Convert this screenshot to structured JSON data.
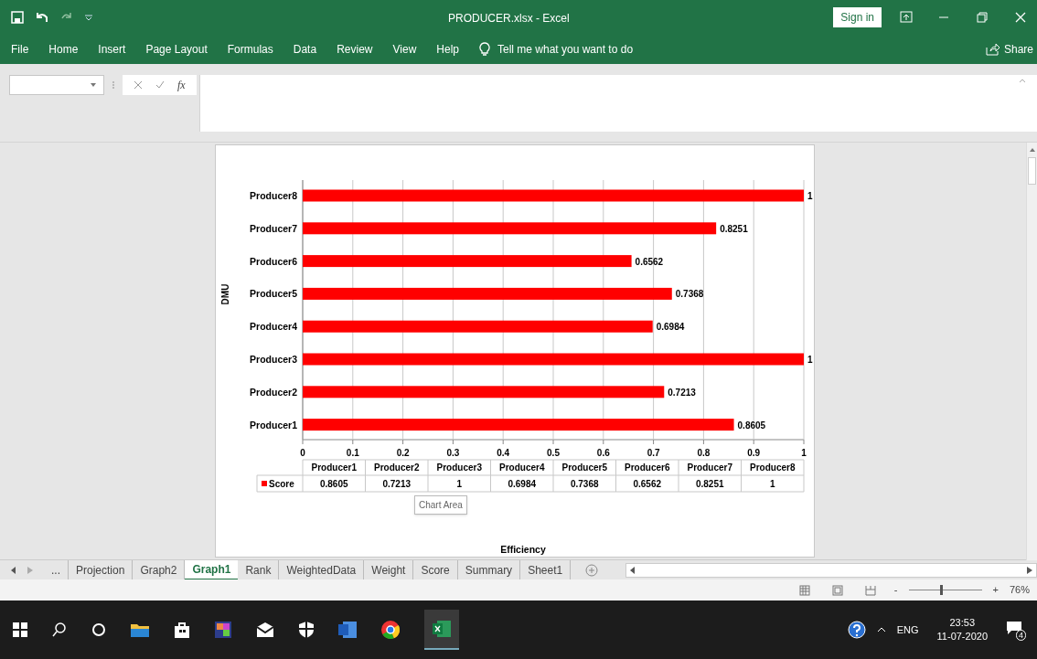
{
  "window": {
    "title": "PRODUCER.xlsx  -  Excel",
    "sign_in": "Sign in"
  },
  "ribbon_tabs": [
    {
      "label": "File"
    },
    {
      "label": "Home"
    },
    {
      "label": "Insert"
    },
    {
      "label": "Page Layout"
    },
    {
      "label": "Formulas"
    },
    {
      "label": "Data"
    },
    {
      "label": "Review"
    },
    {
      "label": "View"
    },
    {
      "label": "Help"
    }
  ],
  "tell_me": "Tell me what you want to do",
  "share": "Share",
  "formula_bar": {
    "fx": "fx"
  },
  "chart": {
    "chart_data": {
      "type": "bar",
      "orientation": "horizontal",
      "annotations": [
        {
          "text": "Efficiency"
        }
      ],
      "ylabel": "DMU",
      "grid": true,
      "categories": [
        "Producer8",
        "Producer7",
        "Producer6",
        "Producer5",
        "Producer4",
        "Producer3",
        "Producer2",
        "Producer1"
      ],
      "series": [
        {
          "name": "Score",
          "color": "#ff0000",
          "values": [
            1,
            0.8251,
            0.6562,
            0.7368,
            0.6984,
            1,
            0.7213,
            0.8605
          ]
        }
      ],
      "xlim": [
        0,
        1
      ],
      "xticks": [
        {
          "value": 0,
          "label": "0"
        },
        {
          "value": 0.1,
          "label": "0.1"
        },
        {
          "value": 0.2,
          "label": "0.2"
        },
        {
          "value": 0.3,
          "label": "0.3"
        },
        {
          "value": 0.4,
          "label": "0.4"
        },
        {
          "value": 0.5,
          "label": "0.5"
        },
        {
          "value": 0.6,
          "label": "0.6"
        },
        {
          "value": 0.7,
          "label": "0.7"
        },
        {
          "value": 0.8,
          "label": "0.8"
        },
        {
          "value": 0.9,
          "label": "0.9"
        },
        {
          "value": 1,
          "label": "1"
        }
      ],
      "value_labels": [
        "1",
        "0.8251",
        "0.6562",
        "0.7368",
        "0.6984",
        "1",
        "0.7213",
        "0.8605"
      ]
    },
    "data_table": {
      "columns": [
        "Producer1",
        "Producer2",
        "Producer3",
        "Producer4",
        "Producer5",
        "Producer6",
        "Producer7",
        "Producer8"
      ],
      "cells": [
        "0.8605",
        "0.7213",
        "1",
        "0.6984",
        "0.7368",
        "0.6562",
        "0.8251",
        "1"
      ]
    },
    "tooltip": "Chart Area"
  },
  "sheet_tabs": [
    {
      "label": "...",
      "selected": false
    },
    {
      "label": "Projection",
      "selected": false
    },
    {
      "label": "Graph2",
      "selected": false
    },
    {
      "label": "Graph1",
      "selected": true
    },
    {
      "label": "Rank",
      "selected": false
    },
    {
      "label": "WeightedData",
      "selected": false
    },
    {
      "label": "Weight",
      "selected": false
    },
    {
      "label": "Score",
      "selected": false
    },
    {
      "label": "Summary",
      "selected": false
    },
    {
      "label": "Sheet1",
      "selected": false
    }
  ],
  "status_bar": {
    "zoom": "76%",
    "zoom_slider": {
      "level": 0.45
    },
    "minus": "-",
    "plus": "+"
  },
  "taskbar": {
    "language": "ENG",
    "time": "23:53",
    "date": "11-07-2020",
    "notifications": "4"
  }
}
